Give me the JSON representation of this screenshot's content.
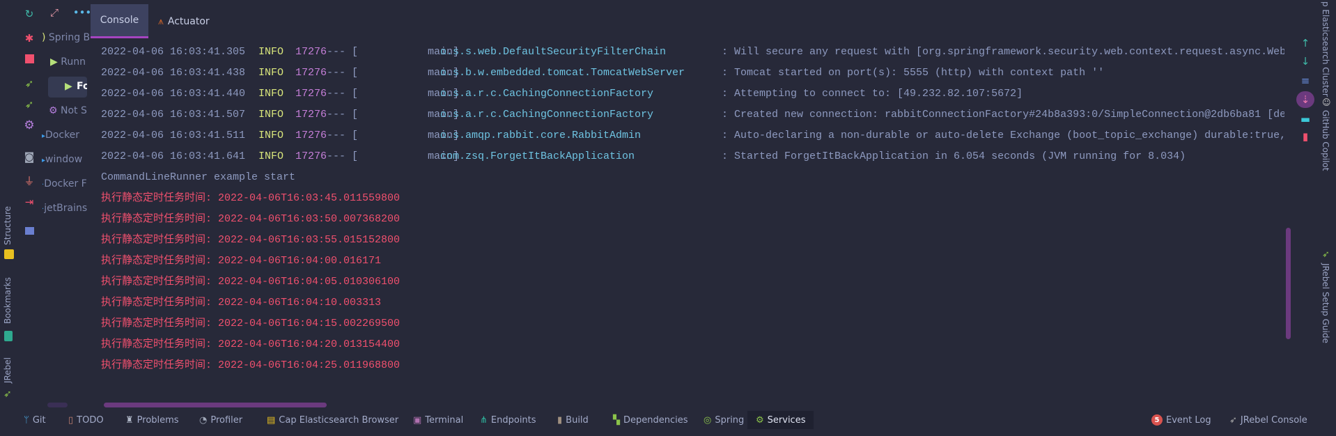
{
  "left_strip": {
    "items": [
      {
        "label": "Structure",
        "icon": "structure-icon"
      },
      {
        "label": "Bookmarks",
        "icon": "bookmarks-icon"
      },
      {
        "label": "JRebel",
        "icon": "jrebel-icon"
      }
    ]
  },
  "right_strip": {
    "items": [
      {
        "label": "p Elasticsearch Cluster"
      },
      {
        "label": "GitHub Copilot",
        "icon": "copilot-icon"
      },
      {
        "label": "JRebel Setup Guide",
        "icon": "jrebel-icon"
      }
    ]
  },
  "services_tree": {
    "items": [
      "Spring B",
      "Runn",
      "Fo",
      "Not S",
      "Docker",
      "window",
      "Docker F",
      "jetBrains"
    ]
  },
  "tabs": [
    {
      "label": "Console",
      "active": true
    },
    {
      "label": "Actuator",
      "active": false
    }
  ],
  "log_lines": [
    {
      "ts": "2022-04-06 16:03:41.305",
      "level": "INFO",
      "pid": "17276",
      "sep": "--- [",
      "thread": "main]",
      "cls": "o.s.s.web.DefaultSecurityFilterChain",
      "msg": ": Will secure any request with [org.springframework.security.web.context.request.async.Web"
    },
    {
      "ts": "2022-04-06 16:03:41.438",
      "level": "INFO",
      "pid": "17276",
      "sep": "--- [",
      "thread": "main]",
      "cls": "o.s.b.w.embedded.tomcat.TomcatWebServer",
      "msg": ": Tomcat started on port(s): 5555 (http) with context path ''"
    },
    {
      "ts": "2022-04-06 16:03:41.440",
      "level": "INFO",
      "pid": "17276",
      "sep": "--- [",
      "thread": "main]",
      "cls": "o.s.a.r.c.CachingConnectionFactory",
      "msg": ": Attempting to connect to: [49.232.82.107:5672]"
    },
    {
      "ts": "2022-04-06 16:03:41.507",
      "level": "INFO",
      "pid": "17276",
      "sep": "--- [",
      "thread": "main]",
      "cls": "o.s.a.r.c.CachingConnectionFactory",
      "msg": ": Created new connection: rabbitConnectionFactory#24b8a393:0/SimpleConnection@2db6ba81 [de"
    },
    {
      "ts": "2022-04-06 16:03:41.511",
      "level": "INFO",
      "pid": "17276",
      "sep": "--- [",
      "thread": "main]",
      "cls": "o.s.amqp.rabbit.core.RabbitAdmin",
      "msg": ": Auto-declaring a non-durable or auto-delete Exchange (boot_topic_exchange) durable:true,"
    },
    {
      "ts": "2022-04-06 16:03:41.641",
      "level": "INFO",
      "pid": "17276",
      "sep": "--- [",
      "thread": "main]",
      "cls": "com.zsq.ForgetItBackApplication",
      "msg": ": Started ForgetItBackApplication in 6.054 seconds (JVM running for 8.034)"
    }
  ],
  "plain_line": "CommandLineRunner example start",
  "red_lines": [
    "执行静态定时任务时间: 2022-04-06T16:03:45.011559800",
    "执行静态定时任务时间: 2022-04-06T16:03:50.007368200",
    "执行静态定时任务时间: 2022-04-06T16:03:55.015152800",
    "执行静态定时任务时间: 2022-04-06T16:04:00.016171",
    "执行静态定时任务时间: 2022-04-06T16:04:05.010306100",
    "执行静态定时任务时间: 2022-04-06T16:04:10.003313",
    "执行静态定时任务时间: 2022-04-06T16:04:15.002269500",
    "执行静态定时任务时间: 2022-04-06T16:04:20.013154400",
    "执行静态定时任务时间: 2022-04-06T16:04:25.011968800"
  ],
  "status_bar": {
    "left": [
      {
        "label": "Git"
      },
      {
        "label": "TODO"
      },
      {
        "label": "Problems"
      },
      {
        "label": "Profiler"
      },
      {
        "label": "Cap Elasticsearch Browser"
      },
      {
        "label": "Terminal"
      },
      {
        "label": "Endpoints"
      },
      {
        "label": "Build"
      },
      {
        "label": "Dependencies"
      },
      {
        "label": "Spring"
      },
      {
        "label": "Services",
        "active": true
      }
    ],
    "event_log": {
      "label": "Event Log",
      "badge": "5"
    },
    "jrebel_console": {
      "label": "JRebel Console"
    }
  },
  "colors": {
    "background": "#272939",
    "accent": "#a545c0",
    "info": "#d9e67c",
    "pid": "#c67fd9",
    "logger": "#6fc4e2",
    "error": "#f0506e"
  }
}
